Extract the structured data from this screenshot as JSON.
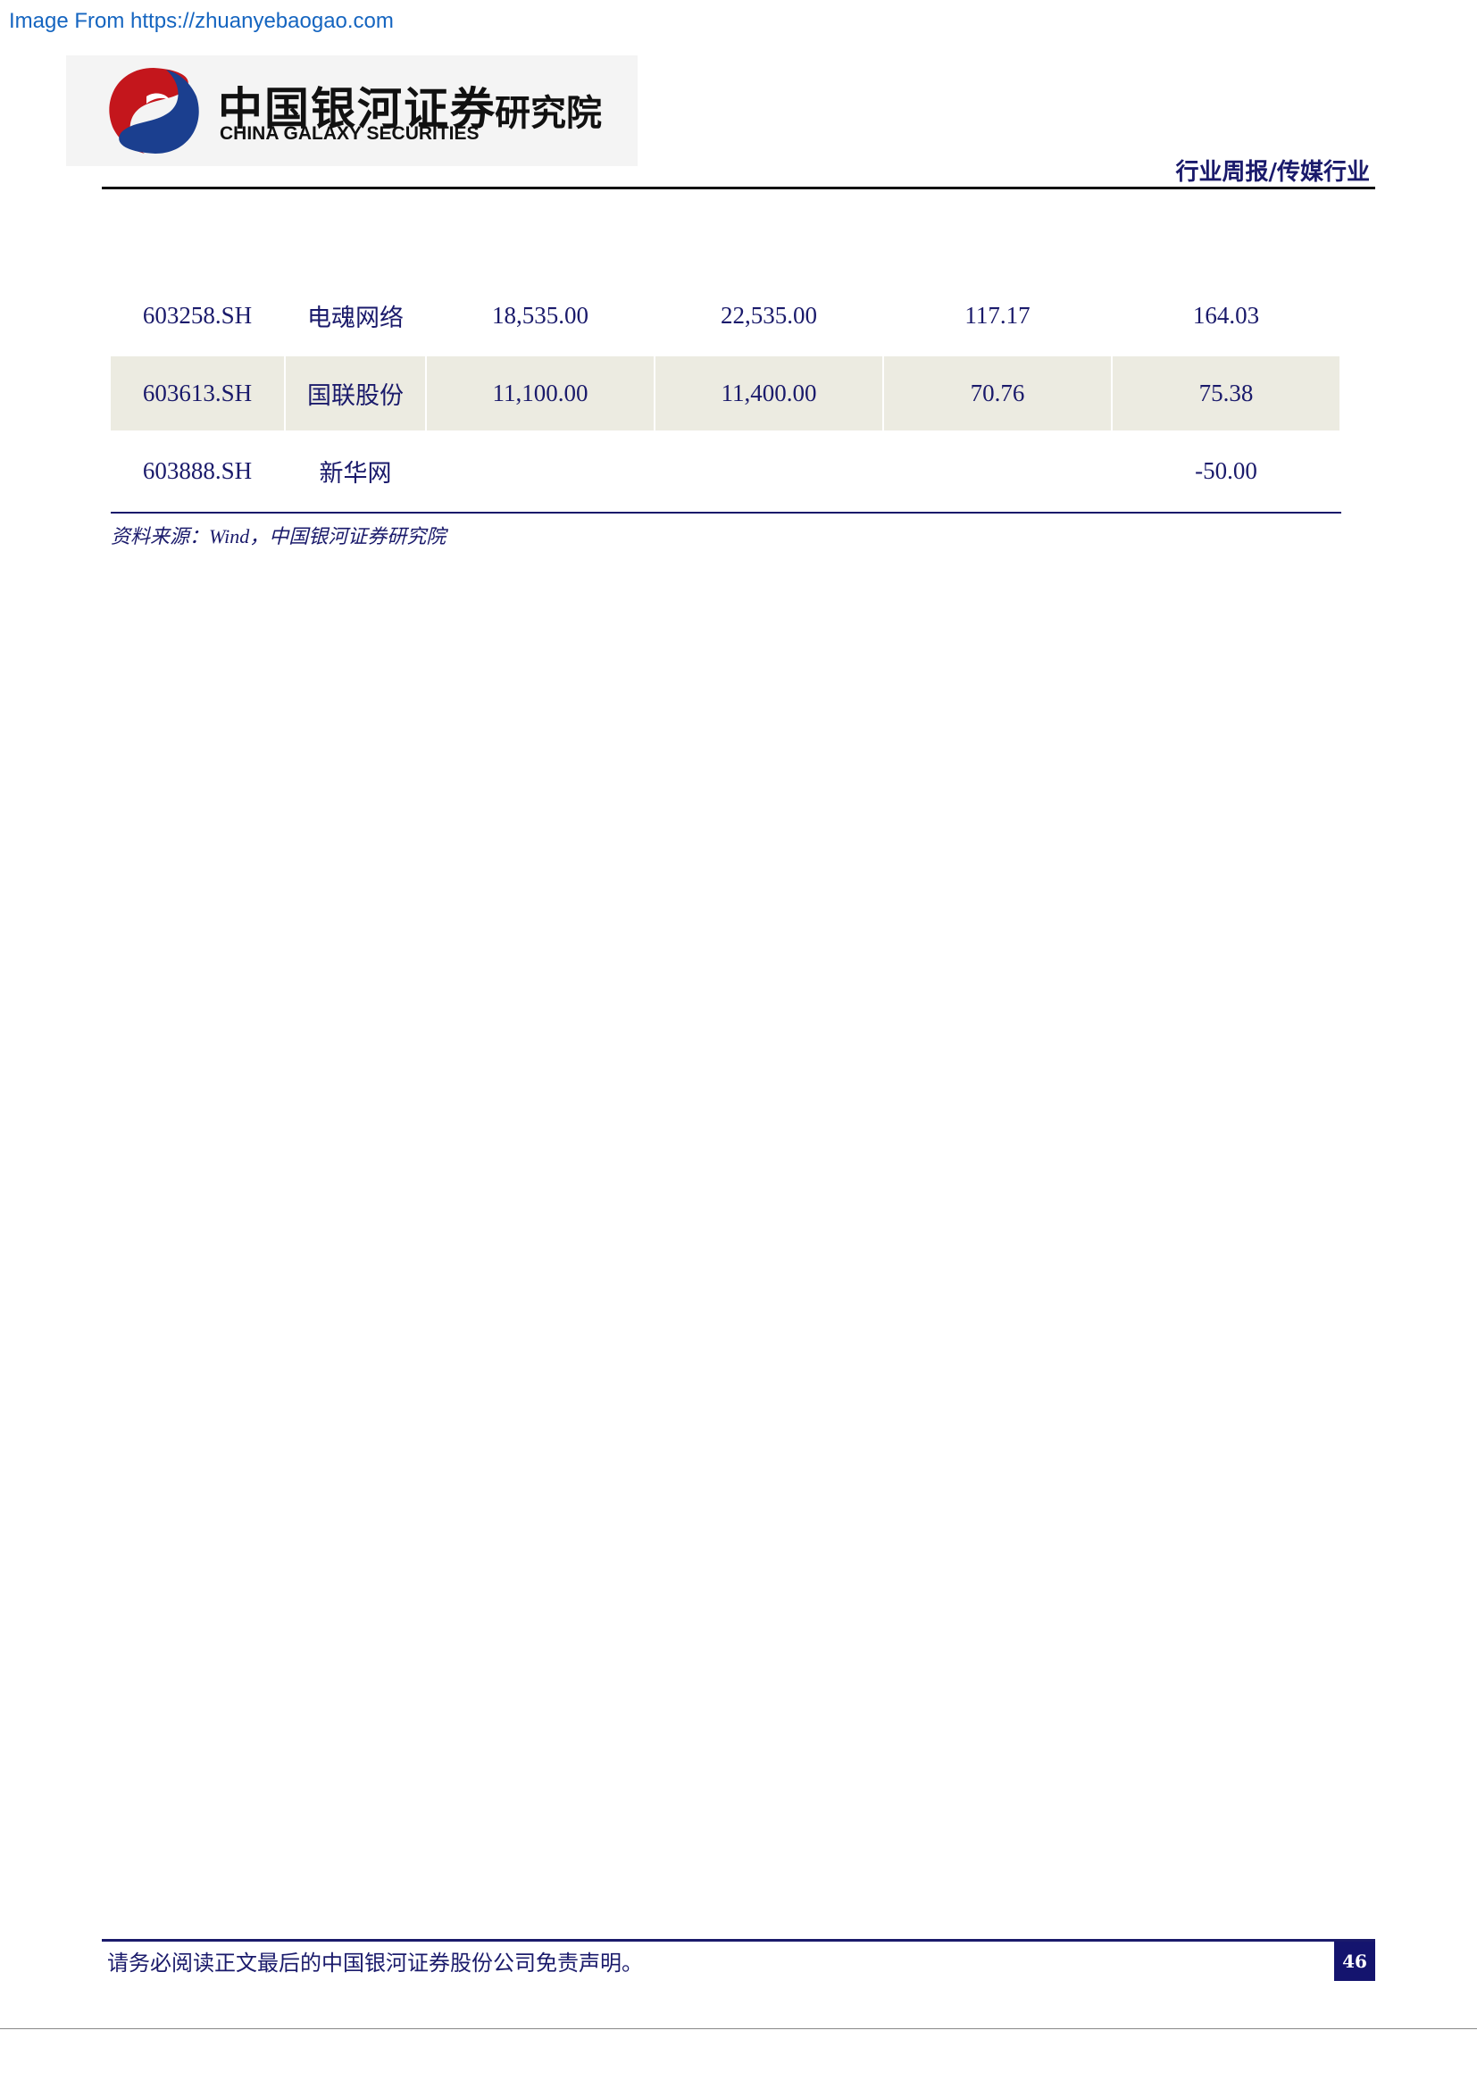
{
  "watermark": "Image From https://zhuanyebaogao.com",
  "logo": {
    "cn": "中国银河证券",
    "en": "CHINA GALAXY SECURITIES",
    "institute": "研究院",
    "colors": {
      "red": "#c4161c",
      "blue": "#1b3f8f"
    }
  },
  "header": {
    "category": "行业周报/传媒行业"
  },
  "table": {
    "rows": [
      {
        "code": "603258.SH",
        "name": "电魂网络",
        "v1": "18,535.00",
        "v2": "22,535.00",
        "v3": "117.17",
        "v4": "164.03"
      },
      {
        "code": "603613.SH",
        "name": "国联股份",
        "v1": "11,100.00",
        "v2": "11,400.00",
        "v3": "70.76",
        "v4": "75.38"
      },
      {
        "code": "603888.SH",
        "name": "新华网",
        "v1": "",
        "v2": "",
        "v3": "",
        "v4": "-50.00"
      }
    ],
    "source": "资料来源：Wind，中国银河证券研究院"
  },
  "footer": {
    "note": "请务必阅读正文最后的中国银河证券股份公司免责声明。",
    "page": "46"
  }
}
